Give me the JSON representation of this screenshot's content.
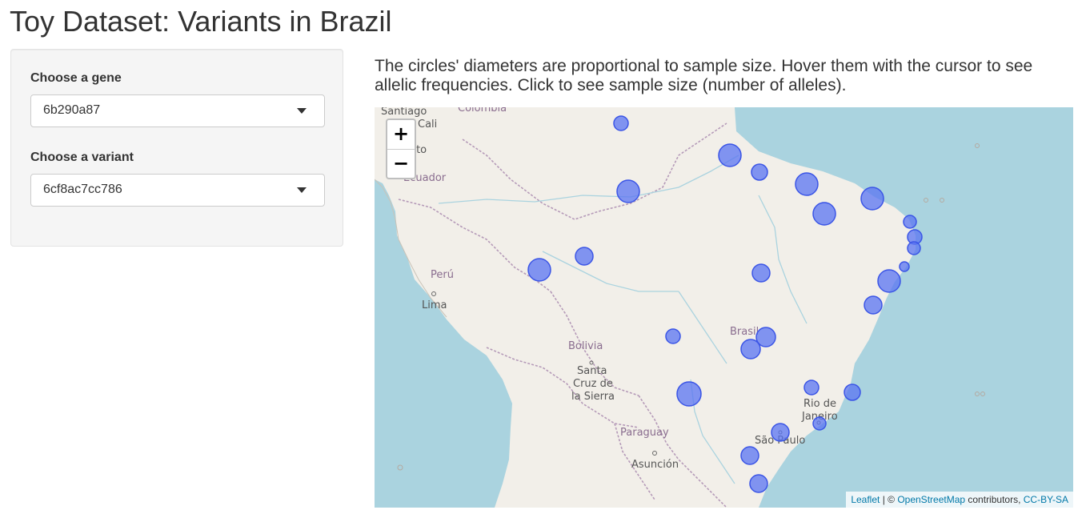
{
  "app": {
    "title": "Toy Dataset: Variants in Brazil"
  },
  "sidebar": {
    "gene": {
      "label": "Choose a gene",
      "value": "6b290a87"
    },
    "variant": {
      "label": "Choose a variant",
      "value": "6cf8ac7cc786"
    }
  },
  "main": {
    "description": "The circles' diameters are proportional to sample size. Hover them with the cursor to see allelic frequencies. Click to see sample size (number of alleles)."
  },
  "map": {
    "zoom_in": "+",
    "zoom_out": "−",
    "labels": {
      "santiago": "Santiago",
      "cali": "Cali",
      "quito": "Quito",
      "ecuador": "Ecuador",
      "colombia": "Colombia",
      "peru": "Perú",
      "lima": "Lima",
      "bolivia": "Bolivia",
      "santa_cruz_1": "Santa",
      "santa_cruz_2": "Cruz de",
      "santa_cruz_3": "la Sierra",
      "brasil": "Brasil",
      "paraguay": "Paraguay",
      "asuncion": "Asunción",
      "rio_1": "Rio de",
      "rio_2": "Janeiro",
      "sao_paulo": "São Paulo"
    },
    "attribution": {
      "leaflet": "Leaflet",
      "sep1": " | © ",
      "osm": "OpenStreetMap",
      "contributors": " contributors, ",
      "license": "CC-BY-SA"
    },
    "colors": {
      "water": "#aad3df",
      "land": "#f2efe9",
      "border": "#b59ab8",
      "marker_fill": "#5a74f2",
      "marker_stroke": "#3b55e6"
    }
  }
}
